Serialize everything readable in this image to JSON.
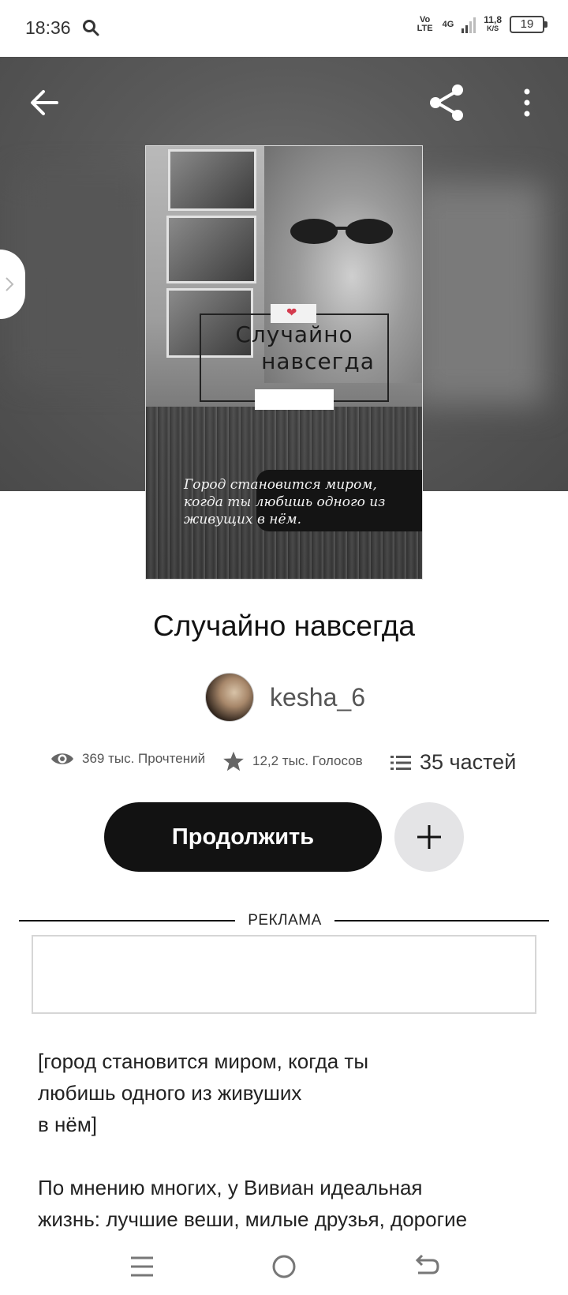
{
  "status_bar": {
    "time": "18:36",
    "network_volte": "Vo LTE",
    "network_type": "4G",
    "speed_value": "11,8",
    "speed_unit": "K/S",
    "battery": "19"
  },
  "header": {
    "back_icon": "arrow-left-icon",
    "share_icon": "share-icon",
    "more_icon": "more-vertical-icon"
  },
  "cover": {
    "title_line1": "Случайно",
    "title_line2": "навсегда",
    "quote": "Город становится миром, когда ты любишь одного из живущих в нём."
  },
  "book": {
    "title": "Случайно навсегда",
    "author": "kesha_6"
  },
  "stats": {
    "reads": "369 тыс. Прочтений",
    "votes": "12,2 тыс. Голосов",
    "parts": "35 частей"
  },
  "actions": {
    "continue_label": "Продолжить"
  },
  "ad": {
    "label": "РЕКЛАМА"
  },
  "description": {
    "text": "[город становится миром, когда ты\nлюбишь одного из живуших\n в нём]\n\nПо мнению многих, у Вивиан идеальная\nжизнь: лучшие веши, милые друзья, дорогие"
  },
  "colors": {
    "primary_button": "#121212",
    "add_button": "#e4e4e6",
    "hero_background": "#5a5a5a"
  }
}
